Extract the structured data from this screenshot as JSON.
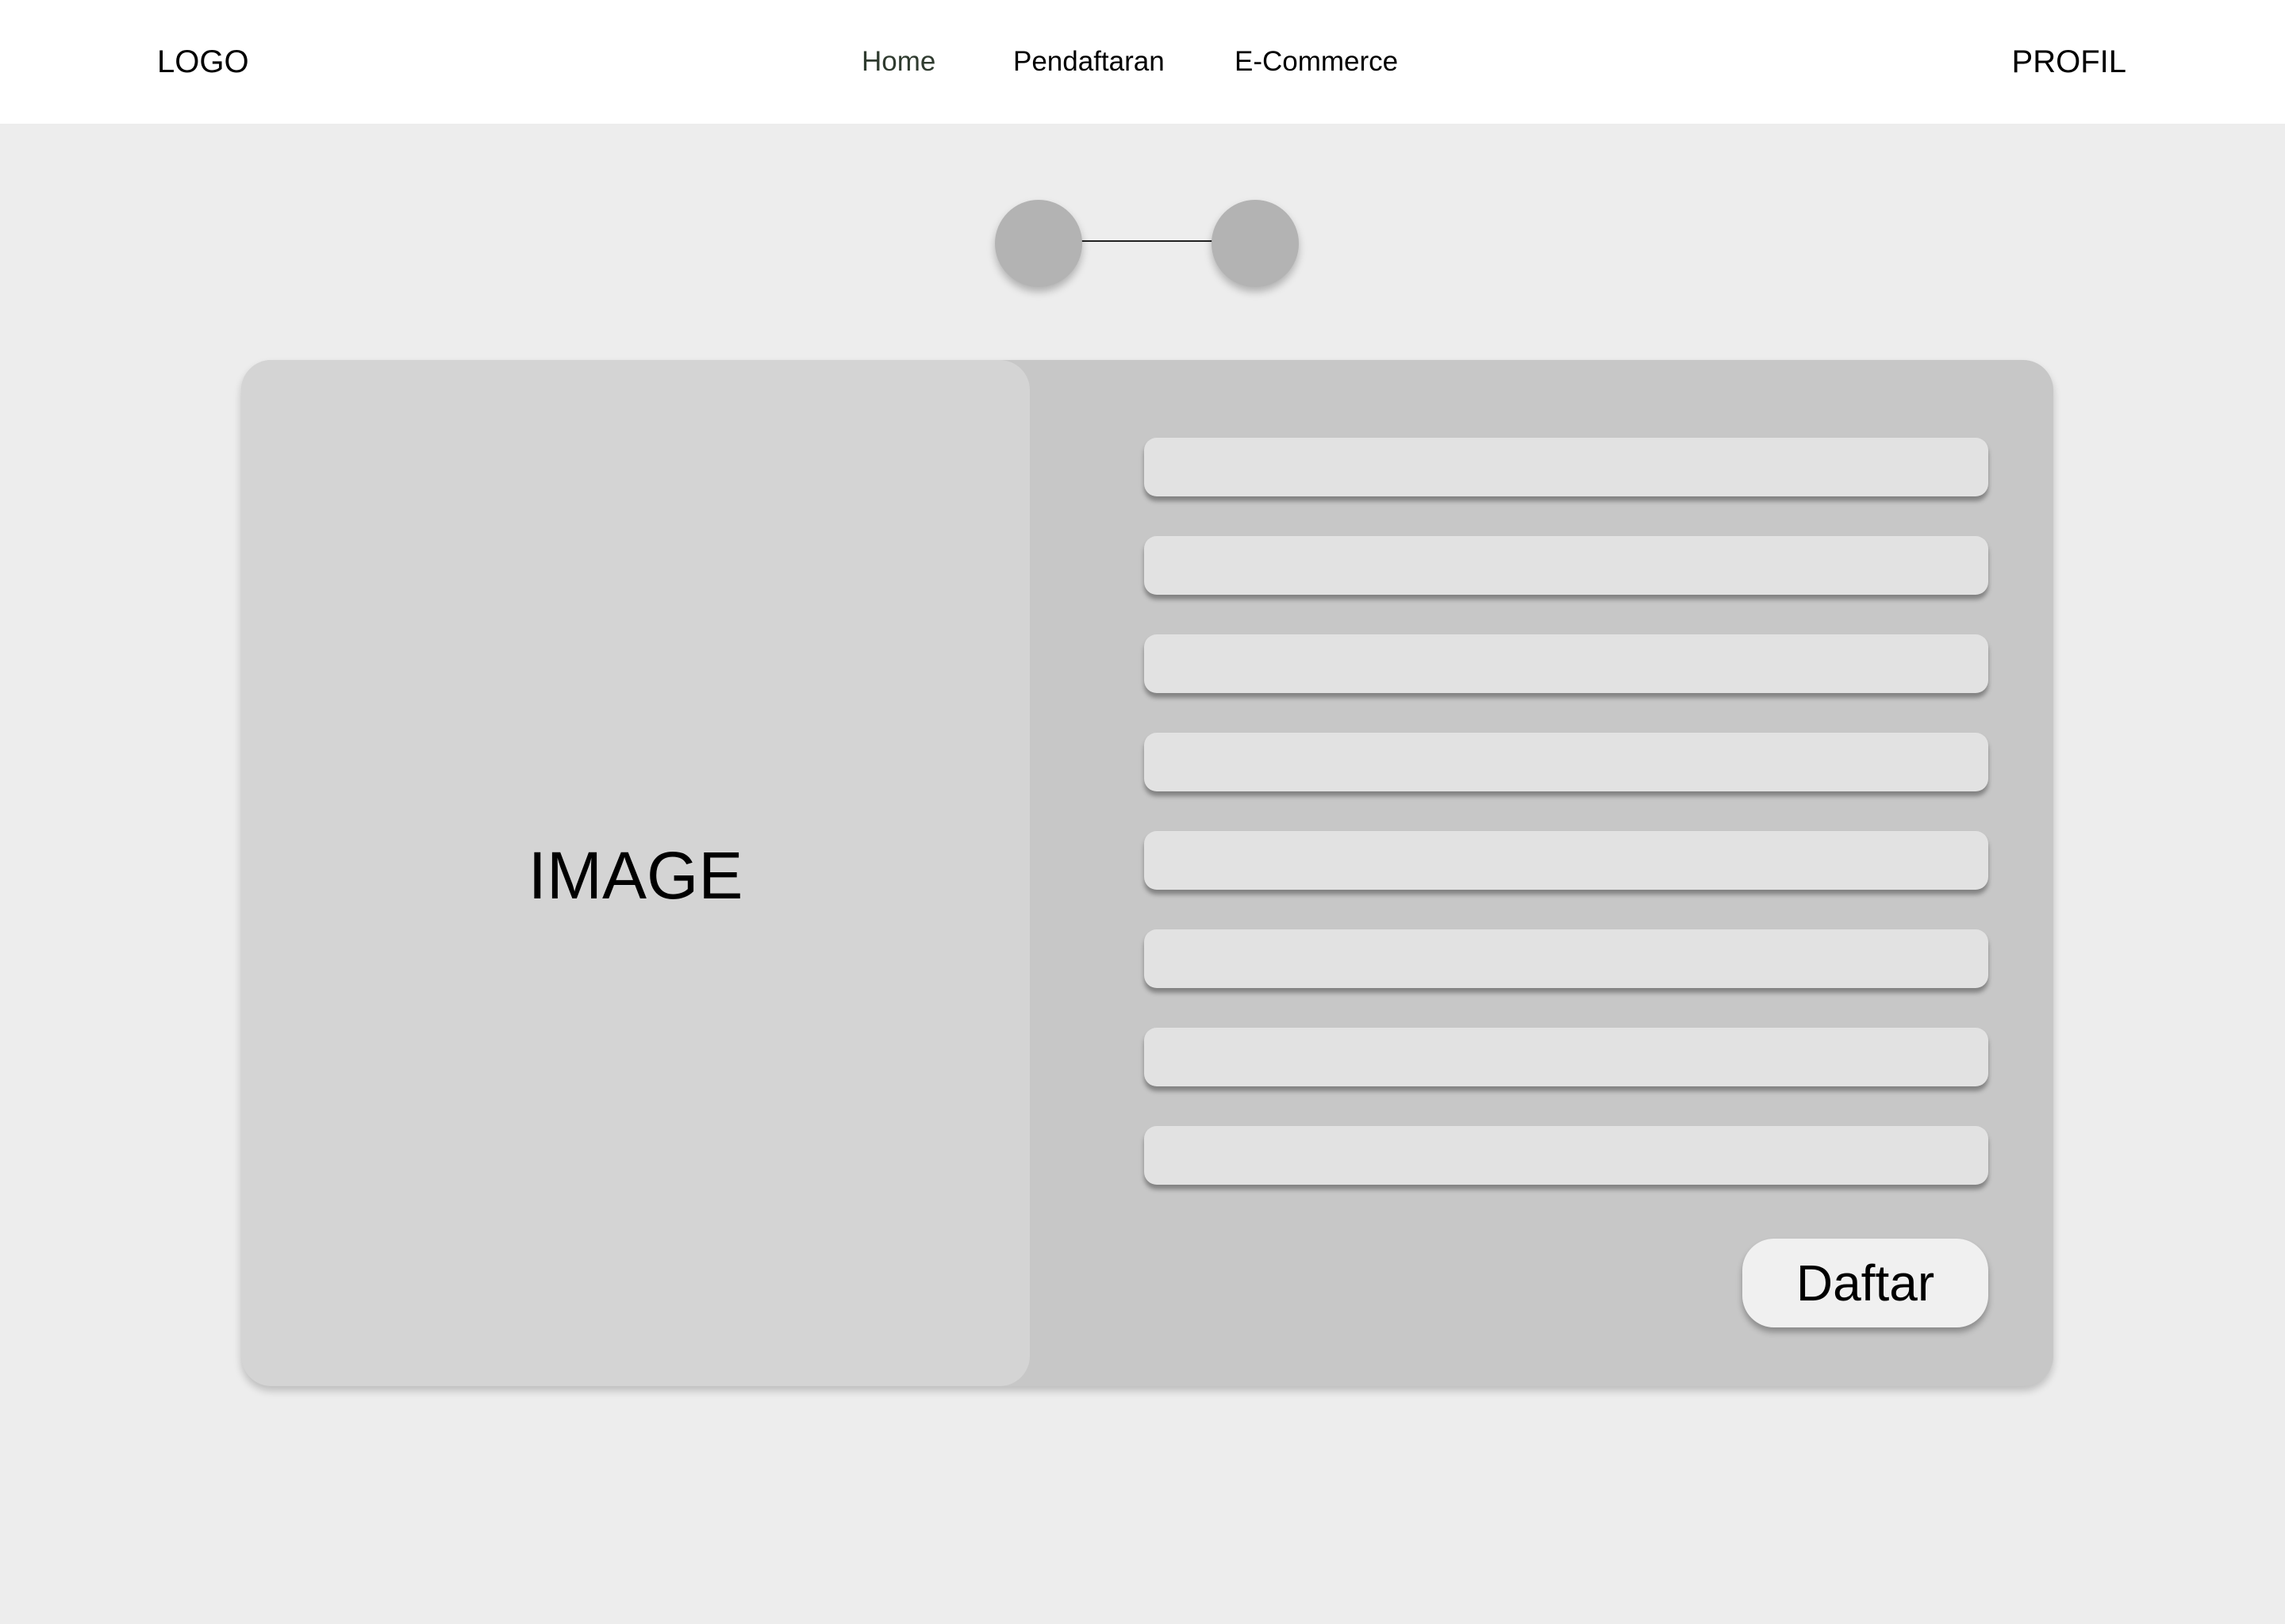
{
  "header": {
    "logo": "LOGO",
    "nav": [
      {
        "label": "Home",
        "active": true
      },
      {
        "label": "Pendaftaran",
        "active": false
      },
      {
        "label": "E-Commerce",
        "active": false
      }
    ],
    "profile": "PROFIL"
  },
  "stepper": {
    "steps": 2,
    "step_color": "#b3b3b3"
  },
  "form": {
    "image_placeholder": "IMAGE",
    "fields": [
      "",
      "",
      "",
      "",
      "",
      "",
      "",
      ""
    ],
    "submit_label": "Daftar"
  },
  "colors": {
    "page_background": "#ededed",
    "header_background": "#ffffff",
    "card_background": "#c7c7c7",
    "image_panel_background": "#d4d4d4",
    "field_background": "#e2e2e2",
    "button_background": "#f0f0f0",
    "active_nav": "#2f3b2f"
  }
}
